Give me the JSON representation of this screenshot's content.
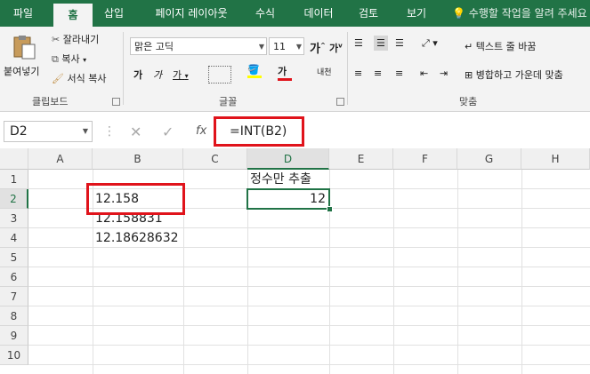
{
  "tabs": [
    "파일",
    "홈",
    "삽입",
    "페이지 레이아웃",
    "수식",
    "데이터",
    "검토",
    "보기"
  ],
  "tell_me": "수행할 작업을 알려 주세요",
  "clipboard": {
    "paste": "붙여넣기",
    "cut": "잘라내기",
    "copy": "복사",
    "format_painter": "서식 복사",
    "group": "클립보드"
  },
  "font": {
    "name": "맑은 고딕",
    "size": "11",
    "group": "글꼴",
    "grow": "가",
    "shrink": "가",
    "bold": "가",
    "italic": "가",
    "underline": "가",
    "color": "가",
    "phonetic": "내천"
  },
  "alignment": {
    "wrap": "텍스트 줄 바꿈",
    "merge": "병합하고 가운데 맞춤",
    "group": "맞춤"
  },
  "formula_bar": {
    "name_box": "D2",
    "formula": "=INT(B2)",
    "fx": "fx"
  },
  "columns": [
    "A",
    "B",
    "C",
    "D",
    "E",
    "F",
    "G",
    "H"
  ],
  "rows": [
    "1",
    "2",
    "3",
    "4",
    "5",
    "6",
    "7",
    "8",
    "9",
    "10"
  ],
  "cells": {
    "B2": "12.158",
    "B3": "12.158831",
    "B4": "12.18628632",
    "D1": "정수만 추출",
    "D2": "12"
  },
  "accent": "#217346",
  "highlight": "#e0131b"
}
